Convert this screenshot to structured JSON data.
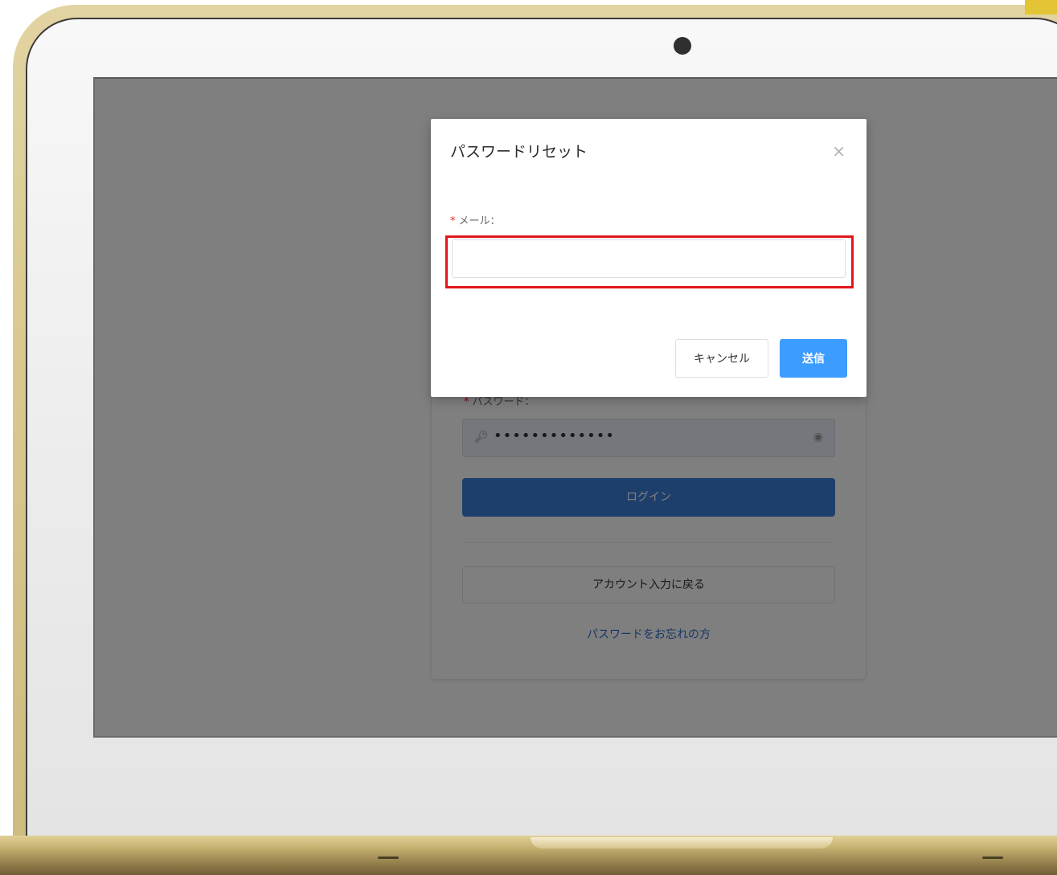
{
  "modal": {
    "title": "パスワードリセット",
    "email_label": "メール：",
    "email_value": "",
    "cancel_label": "キャンセル",
    "submit_label": "送信",
    "close_icon": "×"
  },
  "login_card": {
    "password_label": "パスワード：",
    "password_mask": "•••••••••••••",
    "login_label": "ログイン",
    "back_label": "アカウント入力に戻る",
    "forgot_link": "パスワードをお忘れの方"
  },
  "colors": {
    "highlight": "#e0171c",
    "primary": "#3d9cff",
    "login_button": "#3d7fd6",
    "required_asterisk": "#f5222d"
  },
  "icons": {
    "password_prefix": "key-icon",
    "password_suffix": "eye-icon",
    "close": "close-icon"
  }
}
